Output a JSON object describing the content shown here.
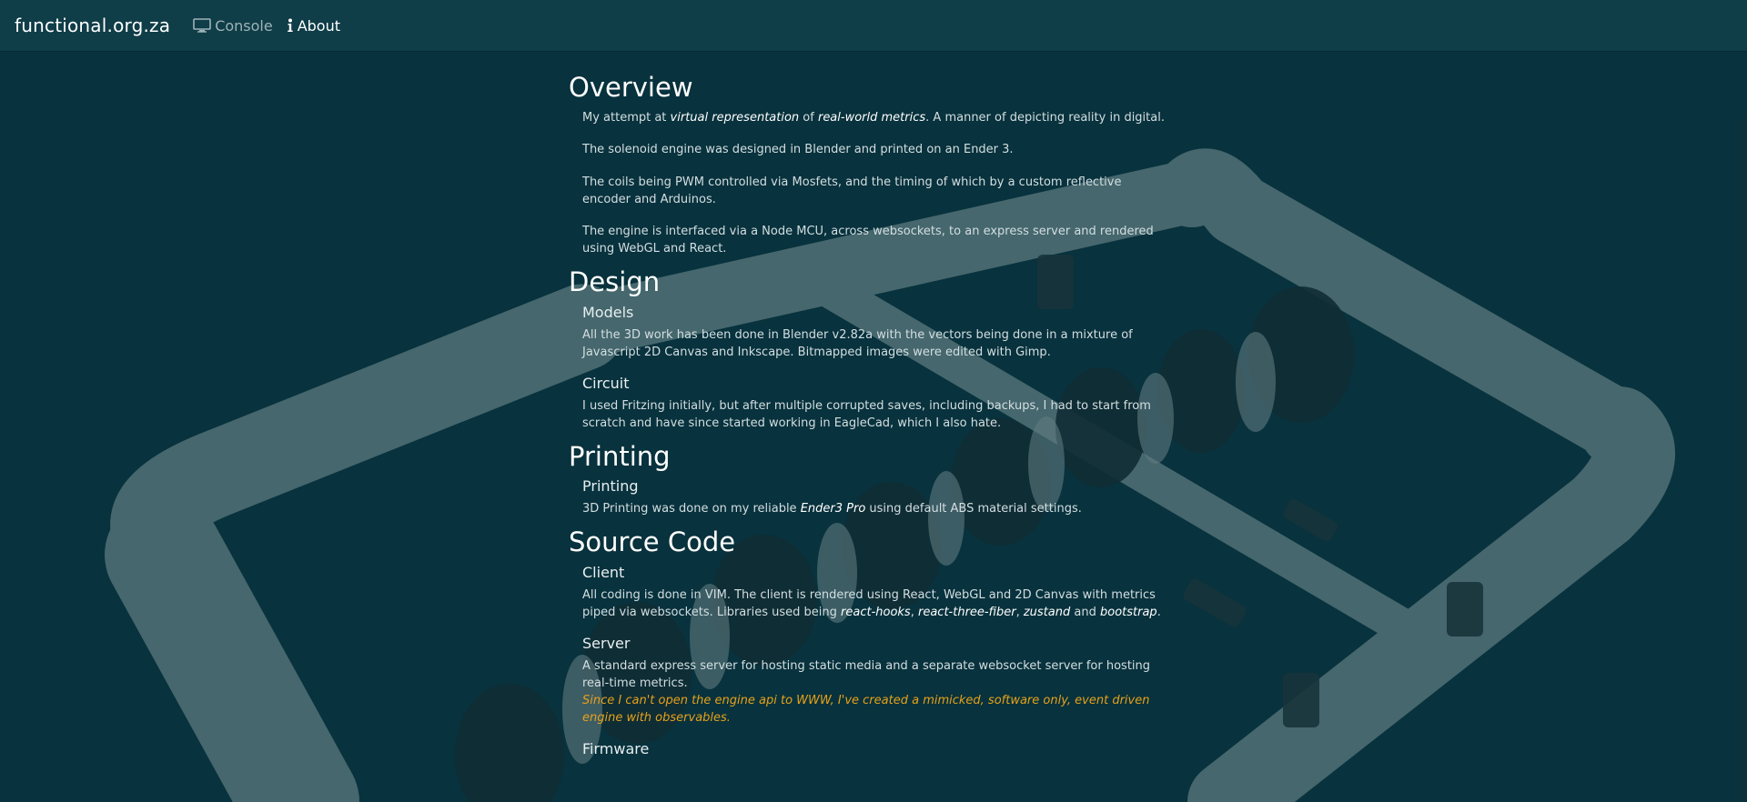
{
  "nav": {
    "brand": "functional.org.za",
    "console_label": "Console",
    "about_label": "About",
    "console_icon": "monitor-icon",
    "about_icon": "info-icon"
  },
  "overview": {
    "title": "Overview",
    "p1_before": "My attempt at ",
    "p1_em1": "virtual representation",
    "p1_mid": " of ",
    "p1_em2": "real-world metrics",
    "p1_after": ". A manner of depicting reality in digital.",
    "p2": "The solenoid engine was designed in Blender and printed on an Ender 3.",
    "p3": "The coils being PWM controlled via Mosfets, and the timing of which by a custom reflective encoder and Arduinos.",
    "p4": "The engine is interfaced via a Node MCU, across websockets, to an express server and rendered using WebGL and React."
  },
  "design": {
    "title": "Design",
    "models_title": "Models",
    "models_text": "All the 3D work has been done in Blender v2.82a with the vectors being done in a mixture of Javascript 2D Canvas and Inkscape. Bitmapped images were edited with Gimp.",
    "circuit_title": "Circuit",
    "circuit_text": "I used Fritzing initially, but after multiple corrupted saves, including backups, I had to start from scratch and have since started working in EagleCad, which I also hate."
  },
  "printing": {
    "title": "Printing",
    "sub_title": "Printing",
    "text_before": "3D Printing was done on my reliable ",
    "text_em": "Ender3 Pro",
    "text_after": " using default ABS material settings."
  },
  "source": {
    "title": "Source Code",
    "client_title": "Client",
    "client_before": "All coding is done in VIM. The client is rendered using React, WebGL and 2D Canvas with metrics piped via websockets. Libraries used being ",
    "client_em1": "react-hooks",
    "client_sep1": ", ",
    "client_em2": "react-three-fiber",
    "client_sep2": ", ",
    "client_em3": "zustand",
    "client_sep3": " and ",
    "client_em4": "bootstrap",
    "client_end": ".",
    "server_title": "Server",
    "server_text": "A standard express server for hosting static media and a separate websocket server for hosting real-time metrics.",
    "server_note": "Since I can't open the engine api to WWW, I've created a mimicked, software only, event driven engine with observables.",
    "firmware_title": "Firmware"
  },
  "colors": {
    "navbar": "#0f3d48",
    "background": "#0b3540",
    "warning": "#e6a11a"
  }
}
